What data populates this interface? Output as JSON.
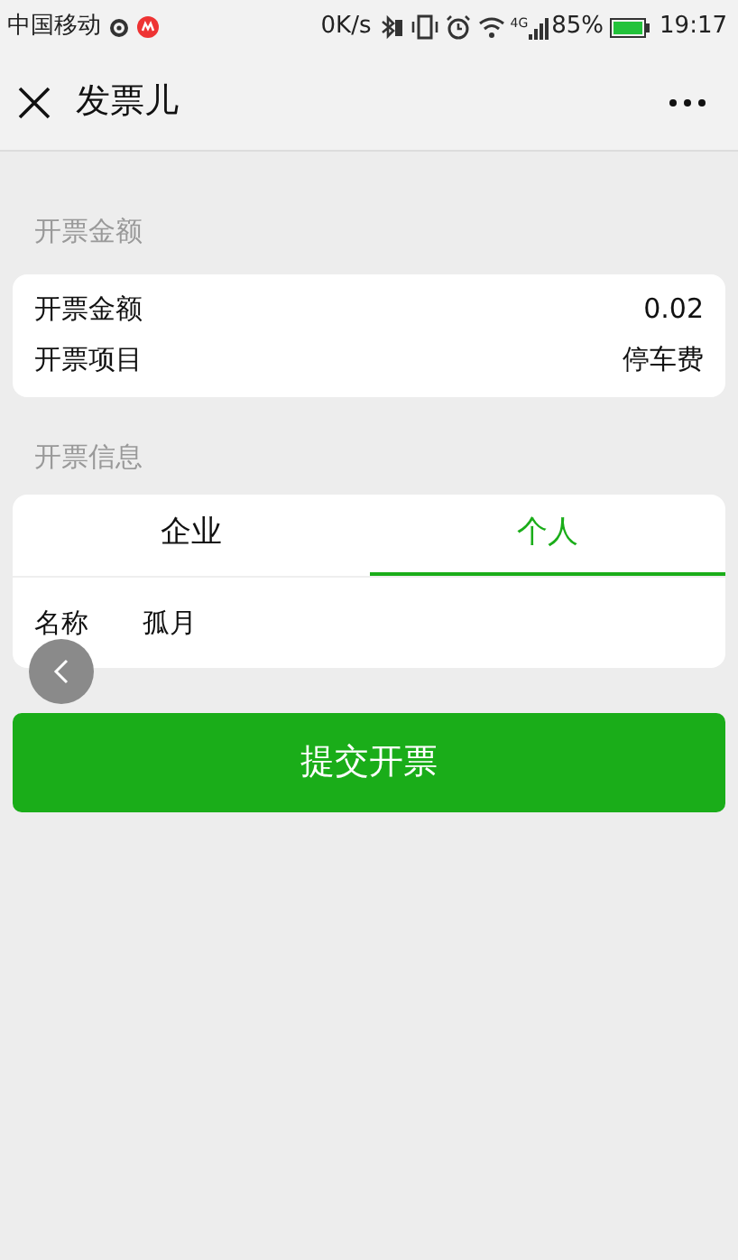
{
  "status_bar": {
    "carrier": "中国移动",
    "speed": "0K/s",
    "network": "4G",
    "battery": "85%",
    "time": "19:17"
  },
  "nav_bar": {
    "title": "发票儿"
  },
  "amount_section": {
    "header": "开票金额",
    "rows": [
      {
        "label": "开票金额",
        "value": "0.02"
      },
      {
        "label": "开票项目",
        "value": "停车费"
      }
    ]
  },
  "info_section": {
    "header": "开票信息",
    "tabs": [
      {
        "label": "企业",
        "selected": false
      },
      {
        "label": "个人",
        "selected": true
      }
    ],
    "fields": [
      {
        "label": "名称",
        "value": "孤月"
      }
    ]
  },
  "submit_button": "提交开票"
}
